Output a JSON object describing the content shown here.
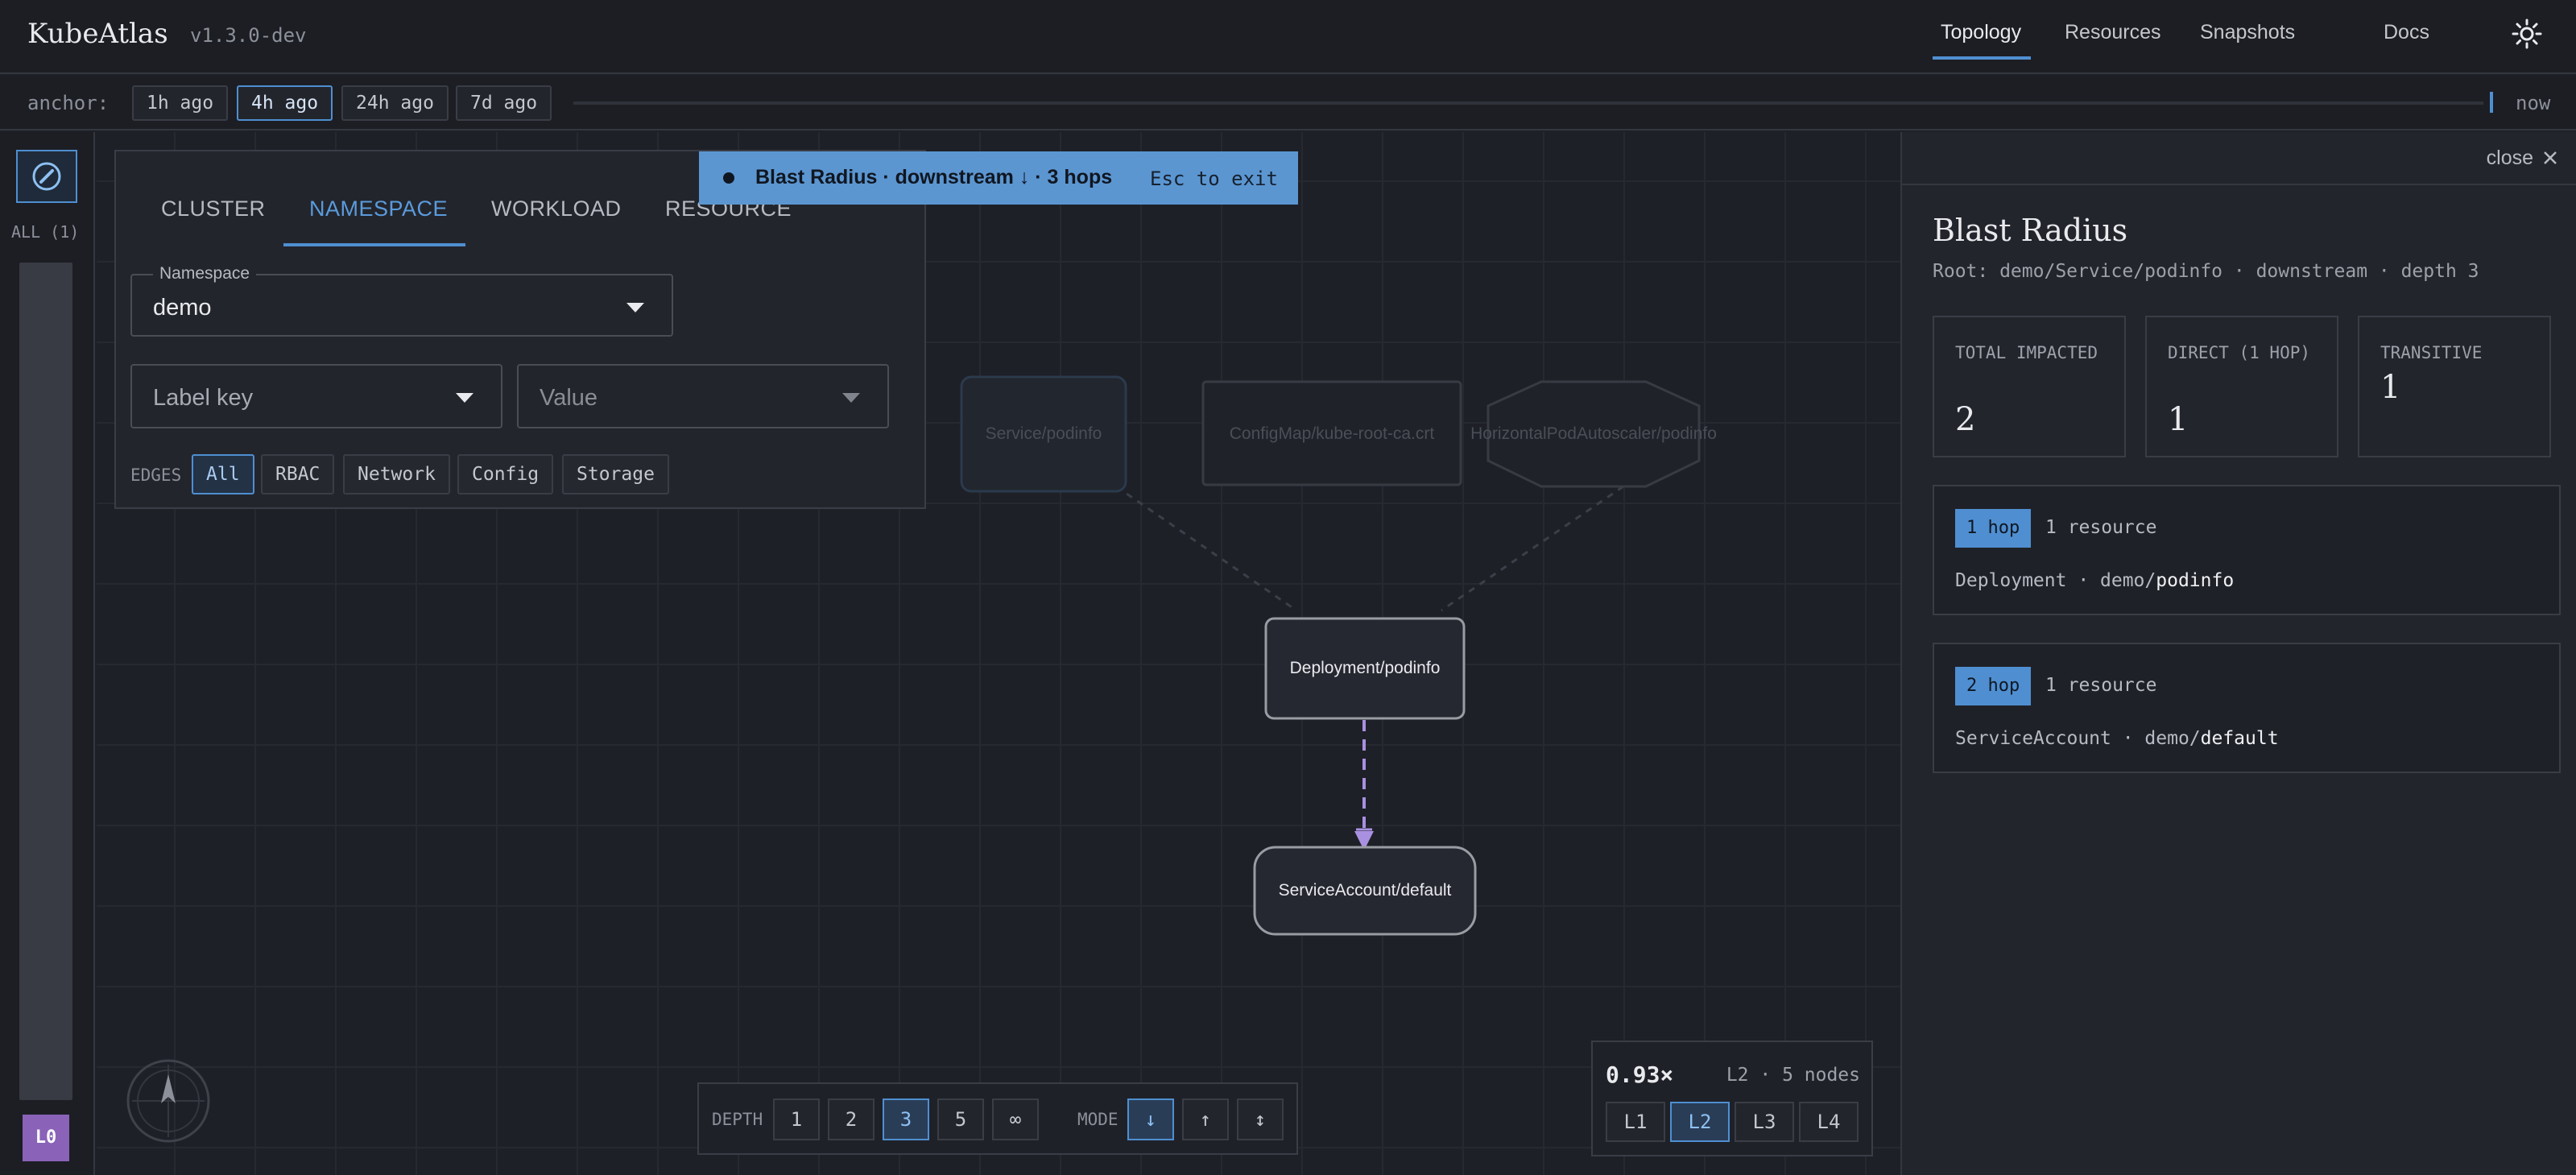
{
  "app": {
    "name": "KubeAtlas",
    "version": "v1.3.0-dev"
  },
  "nav": {
    "items": [
      {
        "label": "Topology",
        "active": true
      },
      {
        "label": "Resources"
      },
      {
        "label": "Snapshots"
      },
      {
        "label": "Docs"
      }
    ],
    "theme_icon": "sun-icon"
  },
  "timebar": {
    "anchor_label": "anchor:",
    "options": [
      "1h ago",
      "4h ago",
      "24h ago",
      "7d ago"
    ],
    "selected": "4h ago",
    "now_label": "now"
  },
  "rail": {
    "all_label": "ALL (1)",
    "level_badge": "L0",
    "compass_icon": "compass-icon"
  },
  "filter": {
    "tabs": [
      "CLUSTER",
      "NAMESPACE",
      "WORKLOAD",
      "RESOURCE"
    ],
    "active_tab": "NAMESPACE",
    "namespace": {
      "legend": "Namespace",
      "value": "demo"
    },
    "label_key_placeholder": "Label key",
    "label_value_placeholder": "Value",
    "edges_label": "EDGES",
    "edge_filters": [
      "All",
      "RBAC",
      "Network",
      "Config",
      "Storage"
    ],
    "edge_selected": "All"
  },
  "blast_banner": {
    "text": "Blast Radius · downstream ↓ · 3 hops",
    "esc_hint": "Esc to exit"
  },
  "graph": {
    "nodes": [
      {
        "id": "svc",
        "label": "Service/podinfo",
        "state": "dimmed"
      },
      {
        "id": "cm",
        "label": "ConfigMap/kube-root-ca.crt",
        "state": "dimmed"
      },
      {
        "id": "hpa",
        "label": "HorizontalPodAutoscaler/podinfo",
        "state": "dimmed"
      },
      {
        "id": "dep",
        "label": "Deployment/podinfo",
        "state": "highlighted"
      },
      {
        "id": "sa",
        "label": "ServiceAccount/default",
        "state": "highlighted"
      }
    ],
    "edges": [
      {
        "from": "svc",
        "to": "dep",
        "state": "dimmed"
      },
      {
        "from": "hpa",
        "to": "dep",
        "state": "dimmed"
      },
      {
        "from": "dep",
        "to": "sa",
        "state": "highlighted"
      }
    ],
    "highlight_color": "#a990e0"
  },
  "controls": {
    "depth_label": "DEPTH",
    "depths": [
      "1",
      "2",
      "3",
      "5",
      "∞"
    ],
    "depth_selected": "3",
    "mode_label": "MODE",
    "modes": [
      "↓",
      "↑",
      "↕"
    ],
    "mode_selected": "↓"
  },
  "zoom": {
    "value": "0.93×",
    "info": "L2 · 5 nodes",
    "levels": [
      "L1",
      "L2",
      "L3",
      "L4"
    ],
    "level_selected": "L2"
  },
  "panel": {
    "close_label": "close",
    "title": "Blast Radius",
    "root_line": "Root: demo/Service/podinfo · downstream · depth 3",
    "stats": [
      {
        "label": "TOTAL IMPACTED",
        "value": "2"
      },
      {
        "label": "DIRECT (1 HOP)",
        "value": "1"
      },
      {
        "label": "TRANSITIVE",
        "value": "1"
      }
    ],
    "hops": [
      {
        "badge": "1 hop",
        "count": "1 resource",
        "kind": "Deployment · demo/",
        "name": "podinfo"
      },
      {
        "badge": "2 hop",
        "count": "1 resource",
        "kind": "ServiceAccount · demo/",
        "name": "default"
      }
    ]
  },
  "colors": {
    "accent": "#4f8fd1",
    "banner": "#5b96d1",
    "level_badge": "#8a63b8",
    "background": "#1e2027"
  }
}
